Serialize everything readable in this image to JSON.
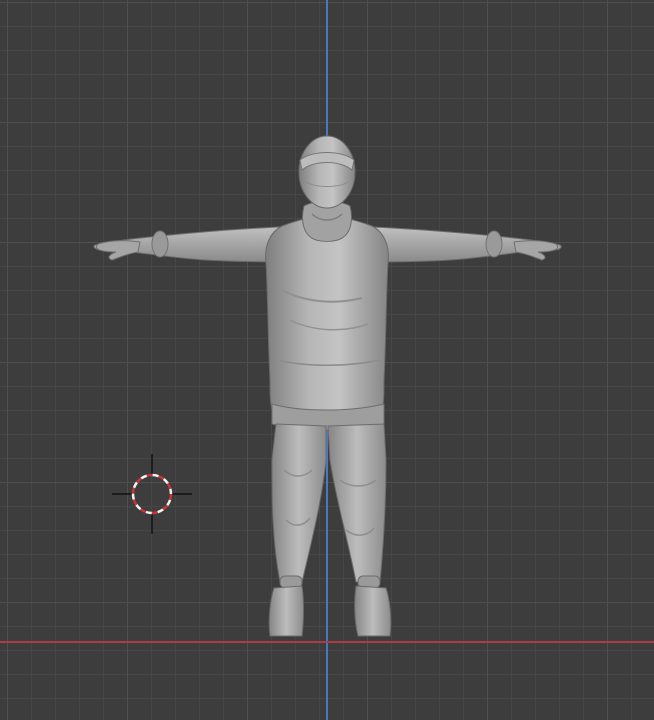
{
  "viewport": {
    "mode": "3d-viewport-front-orthographic",
    "background_color": "#3d3d3d",
    "grid_color_major": "#4f4f4f",
    "grid_color_minor": "#474747"
  },
  "axes": {
    "z_axis_color": "#4a78c0",
    "x_axis_color": "#b0394a"
  },
  "model": {
    "icon": "t-pose-character-icon",
    "pose": "T-pose",
    "material_color": "#a9a9a9"
  },
  "cursor": {
    "icon": "3d-cursor-icon",
    "ring_color_a": "#c8343a",
    "ring_color_b": "#f2f2f2"
  }
}
